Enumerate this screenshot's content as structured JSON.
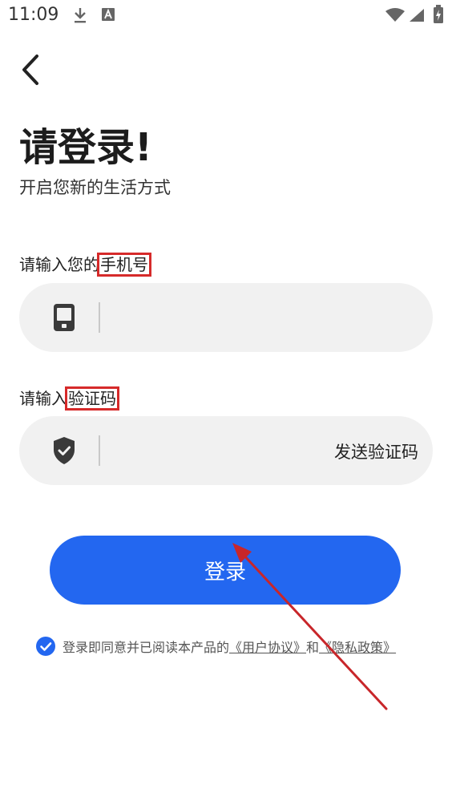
{
  "status_bar": {
    "time": "11:09",
    "icons": [
      "download-icon",
      "text-a-icon",
      "wifi-icon",
      "signal-icon",
      "battery-icon"
    ]
  },
  "header": {
    "title": "请登录!",
    "subtitle": "开启您新的生活方式"
  },
  "phone": {
    "label_prefix": "请输入您的",
    "label_highlight": "手机号",
    "icon": "phone-icon",
    "value": "",
    "placeholder": ""
  },
  "code": {
    "label_prefix": "请输入",
    "label_highlight": "验证码",
    "icon": "shield-check-icon",
    "value": "",
    "placeholder": "",
    "send_label": "发送验证码"
  },
  "login_button": "登录",
  "agreement": {
    "checked": true,
    "text": "登录即同意并已阅读本产品的",
    "user_agreement": "《用户协议》",
    "conjunction": "和",
    "privacy_policy": "《隐私政策》"
  },
  "colors": {
    "primary": "#2367f0",
    "field_bg": "#f1f1f1",
    "highlight_box": "#d62a2a",
    "annotation_arrow": "#c8262a"
  }
}
